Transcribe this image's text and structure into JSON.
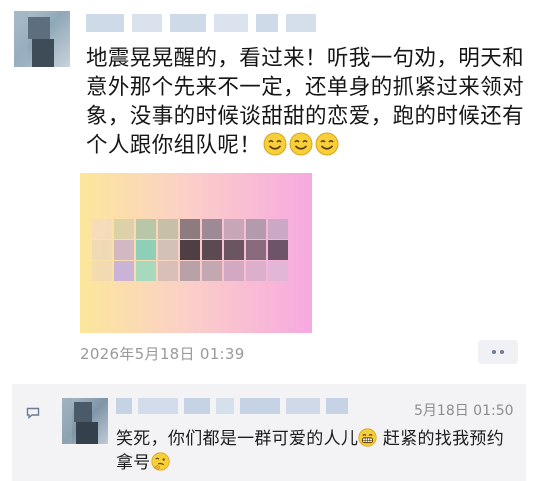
{
  "post": {
    "text": "地震晃晃醒的，看过来！听我一句劝，明天和意外那个先来不一定，还单身的抓紧过来领对象，没事的时候谈甜甜的恋爱，跑的时候还有个人跟你组队呢！",
    "emoji_names": [
      "smile-emoji",
      "smile-emoji",
      "smile-emoji"
    ],
    "timestamp": "2026年5月18日 01:39"
  },
  "comment": {
    "time": "5月18日 01:50",
    "text_part1": "笑死，你们都是一群可爱的人儿",
    "text_part2": " 赶紧的找我预约拿号",
    "emoji_names": [
      "grin-emoji",
      "thinking-emoji"
    ]
  },
  "colors": {
    "timestamp": "#9a9a9a",
    "comment_bg": "#f3f3f5",
    "more_dots": "#6c7b95"
  }
}
